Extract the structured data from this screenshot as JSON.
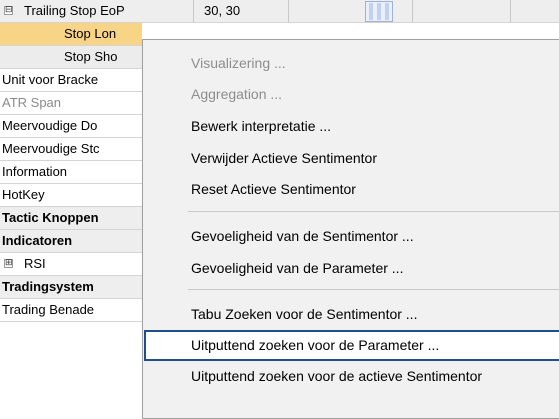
{
  "grid": {
    "top_row": {
      "expander": "⊟",
      "label": "Trailing Stop EoP",
      "value": "30, 30"
    },
    "rows": [
      {
        "label": "Stop Lon"
      },
      {
        "label": "Stop Sho"
      },
      {
        "label": "Unit voor Bracke"
      },
      {
        "label": "ATR Span"
      },
      {
        "label": "Meervoudige Do"
      },
      {
        "label": "Meervoudige Stc"
      },
      {
        "label": "Information"
      },
      {
        "label": "HotKey"
      },
      {
        "label": "Tactic Knoppen"
      },
      {
        "label": "Indicatoren"
      },
      {
        "label": "RSI",
        "expander": "⊞"
      },
      {
        "label": "Tradingsystem"
      },
      {
        "label": "Trading Benade"
      }
    ]
  },
  "menu": {
    "items": [
      {
        "label": "Visualizering ...",
        "enabled": false
      },
      {
        "label": "Aggregation ...",
        "enabled": false
      },
      {
        "label": "Bewerk interpretatie ...",
        "enabled": true
      },
      {
        "label": "Verwijder Actieve Sentimentor",
        "enabled": true
      },
      {
        "label": "Reset Actieve Sentimentor",
        "enabled": true
      },
      {
        "label": "Gevoeligheid van de Sentimentor ...",
        "enabled": true
      },
      {
        "label": "Gevoeligheid van de Parameter ...",
        "enabled": true
      },
      {
        "label": "Tabu Zoeken voor de  Sentimentor ...",
        "enabled": true
      },
      {
        "label": "Uitputtend zoeken voor de  Parameter ...",
        "enabled": true,
        "highlighted": true
      },
      {
        "label": "Uitputtend zoeken voor de actieve Sentimentor",
        "enabled": true
      }
    ]
  },
  "colors": {
    "selected_row": "#f7d486",
    "menu_background": "#f1f1f1",
    "highlight_border": "#1e4f8c",
    "disabled_text": "#8d8d8d"
  }
}
